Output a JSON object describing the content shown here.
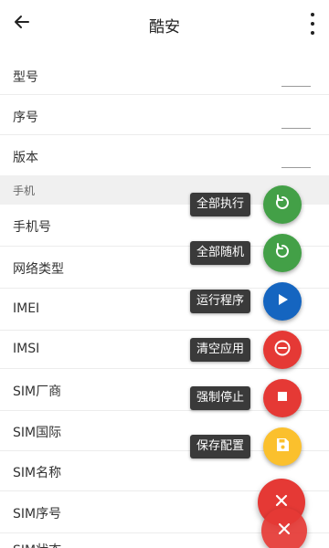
{
  "appbar": {
    "title": "酷安"
  },
  "fields_top": [
    {
      "label": "型号"
    },
    {
      "label": "序号"
    },
    {
      "label": "版本"
    }
  ],
  "section": {
    "label": "手机"
  },
  "fields_phone": [
    {
      "label": "手机号"
    },
    {
      "label": "网络类型"
    },
    {
      "label": "IMEI"
    },
    {
      "label": "IMSI"
    },
    {
      "label": "SIM厂商"
    },
    {
      "label": "SIM国际"
    },
    {
      "label": "SIM名称"
    },
    {
      "label": "SIM序号"
    },
    {
      "label": "SIM状态"
    }
  ],
  "fab_actions": [
    {
      "label": "全部执行",
      "color": "#43a047",
      "icon": "refresh-icon"
    },
    {
      "label": "全部随机",
      "color": "#43a047",
      "icon": "refresh-icon"
    },
    {
      "label": "运行程序",
      "color": "#1565c0",
      "icon": "play-icon"
    },
    {
      "label": "清空应用",
      "color": "#e53935",
      "icon": "minus-circle-icon"
    },
    {
      "label": "强制停止",
      "color": "#e53935",
      "icon": "stop-icon"
    },
    {
      "label": "保存配置",
      "color": "#fbc02d",
      "icon": "save-icon"
    }
  ],
  "fab_main": {
    "color": "#e53935",
    "icon": "close-icon"
  }
}
